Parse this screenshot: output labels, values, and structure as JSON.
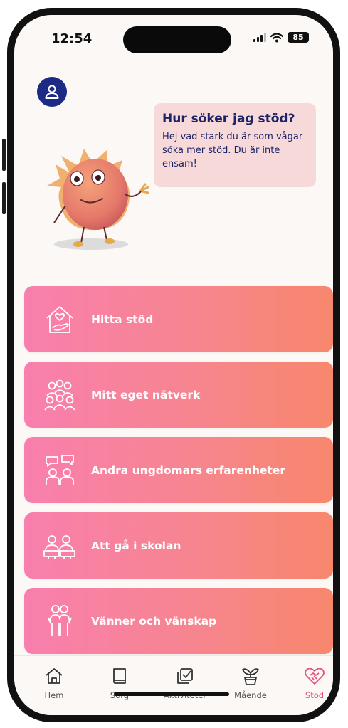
{
  "status_bar": {
    "time": "12:54",
    "battery": "85"
  },
  "speech_bubble": {
    "title": "Hur söker jag stöd?",
    "text": "Hej vad stark du är som vågar söka mer stöd. Du är inte ensam!"
  },
  "menu": [
    {
      "label": "Hitta stöd",
      "icon": "house-heart-hand-icon"
    },
    {
      "label": "Mitt eget nätverk",
      "icon": "group-icon"
    },
    {
      "label": "Andra ungdomars erfarenheter",
      "icon": "people-talking-icon"
    },
    {
      "label": "Att gå i skolan",
      "icon": "students-at-desk-icon"
    },
    {
      "label": "Vänner och vänskap",
      "icon": "friends-icon"
    }
  ],
  "tabbar": [
    {
      "label": "Hem",
      "icon": "home-icon"
    },
    {
      "label": "Sorg",
      "icon": "book-icon"
    },
    {
      "label": "Aktiviteter",
      "icon": "checkbox-icon"
    },
    {
      "label": "Mående",
      "icon": "plant-icon"
    },
    {
      "label": "Stöd",
      "icon": "heart-handshake-icon",
      "active": true
    }
  ],
  "colors": {
    "accent": "#e4547a",
    "avatar": "#1d2a86",
    "card_start": "#f87fae",
    "card_end": "#f7876c",
    "bubble": "#f8d9da"
  }
}
